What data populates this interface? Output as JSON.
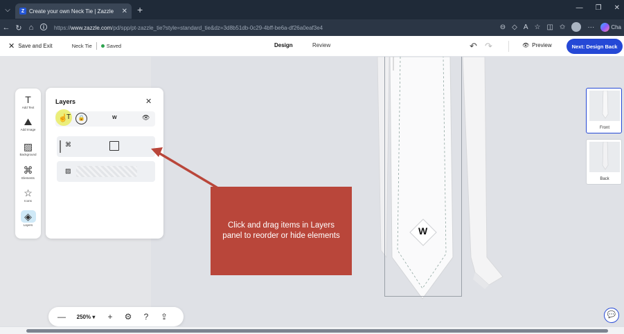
{
  "browser": {
    "tab_title": "Create your own Neck Tie | Zazzle",
    "tab_favicon": "Z",
    "url_prefix": "https://",
    "url_host": "www.zazzle.com",
    "url_path": "/pd/spp/pt-zazzle_tie?style=standard_tie&dz=3d8b51db-0c29-4bff-be6a-df26a0eaf3e4",
    "copilot_label": "Cha"
  },
  "header": {
    "save_exit": "Save and Exit",
    "doc_name": "Neck Tie",
    "saved": "Saved",
    "tab_design": "Design",
    "tab_review": "Review",
    "preview": "Preview",
    "next_button": "Next: Design Back"
  },
  "rail": {
    "items": [
      {
        "label": "Add Text"
      },
      {
        "label": "Add Image"
      },
      {
        "label": "Background"
      },
      {
        "label": "Elements"
      },
      {
        "label": "Icons"
      },
      {
        "label": "Layers"
      }
    ]
  },
  "layers_panel": {
    "title": "Layers",
    "head_letter": "W"
  },
  "callout": {
    "text": "Click and drag items in Layers panel to reorder or hide elements"
  },
  "tie": {
    "monogram": "W"
  },
  "zoom": {
    "value": "250%"
  },
  "thumbnails": {
    "front": "Front",
    "back": "Back"
  },
  "colors": {
    "accent": "#2548d6",
    "callout": "#b9463a",
    "browser_dark": "#1f2a38"
  }
}
